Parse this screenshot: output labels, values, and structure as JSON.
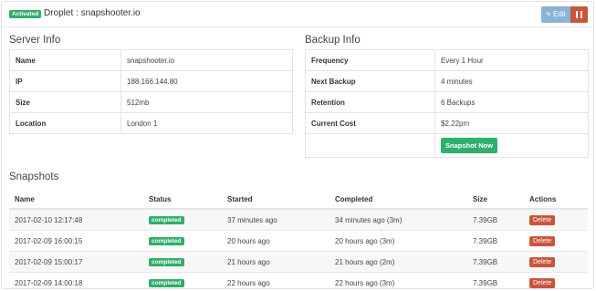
{
  "header": {
    "status_badge": "Activated",
    "title": "Droplet : snapshooter.io",
    "edit_label": "Edit"
  },
  "server_info": {
    "title": "Server Info",
    "rows": [
      {
        "key": "Name",
        "value": "snapshooter.io"
      },
      {
        "key": "IP",
        "value": "188.166.144.80"
      },
      {
        "key": "Size",
        "value": "512mb"
      },
      {
        "key": "Location",
        "value": "London 1"
      }
    ]
  },
  "backup_info": {
    "title": "Backup Info",
    "rows": [
      {
        "key": "Frequency",
        "value": "Every 1 Hour"
      },
      {
        "key": "Next Backup",
        "value": "4 minutes"
      },
      {
        "key": "Retention",
        "value": "6 Backups"
      },
      {
        "key": "Current Cost",
        "value": "$2.22pm"
      }
    ],
    "snapshot_now_label": "Snapshot Now"
  },
  "snapshots": {
    "title": "Snapshots",
    "columns": [
      "Name",
      "Status",
      "Started",
      "Completed",
      "Size",
      "Actions"
    ],
    "rows": [
      {
        "name": "2017-02-10 12:17:48",
        "status": "completed",
        "started": "37 minutes ago",
        "completed": "34 minutes ago (3m)",
        "size": "7.39GB",
        "action": "Delete"
      },
      {
        "name": "2017-02-09 16:00:15",
        "status": "completed",
        "started": "20 hours ago",
        "completed": "20 hours ago (3m)",
        "size": "7.39GB",
        "action": "Delete"
      },
      {
        "name": "2017-02-09 15:00:17",
        "status": "completed",
        "started": "21 hours ago",
        "completed": "21 hours ago (2m)",
        "size": "7.39GB",
        "action": "Delete"
      },
      {
        "name": "2017-02-09 14:00:18",
        "status": "completed",
        "started": "22 hours ago",
        "completed": "22 hours ago (3m)",
        "size": "7.39GB",
        "action": "Delete"
      }
    ]
  },
  "colors": {
    "success": "#2fae6a",
    "danger": "#c9553a",
    "edit_button": "#8ab4d6"
  }
}
